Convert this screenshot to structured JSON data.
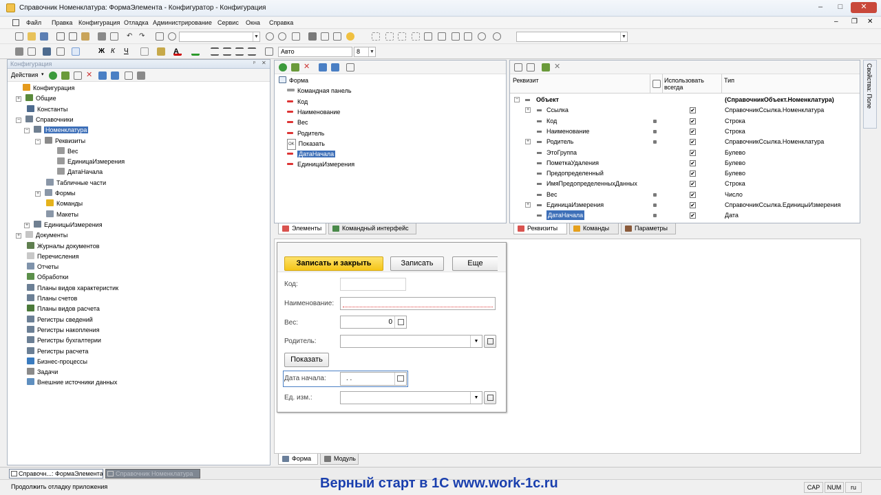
{
  "window": {
    "title": "Справочник Номенклатура: ФормаЭлемента - Конфигуратор - Конфигурация",
    "min": "–",
    "max": "□",
    "close": "✕",
    "inner_min": "–",
    "inner_restore": "❐",
    "inner_close": "✕"
  },
  "menu": [
    "Файл",
    "Правка",
    "Конфигурация",
    "Отладка",
    "Администрирование",
    "Сервис",
    "Окна",
    "Справка"
  ],
  "toolbar": {
    "font_value": "Авто",
    "size_value": "8"
  },
  "config_panel": {
    "title": "Конфигурация",
    "pin": "ᵖ",
    "close": "✕",
    "actions_label": "Действия",
    "tree": [
      {
        "label": "Конфигурация",
        "depth": 0,
        "exp": "",
        "icon": "#e59a1c",
        "sel": false
      },
      {
        "label": "Общие",
        "depth": 1,
        "exp": "+",
        "icon": "#5a8a3c",
        "sel": false
      },
      {
        "label": "Константы",
        "depth": 1,
        "exp": "",
        "icon": "#4d6b8f",
        "sel": false
      },
      {
        "label": "Справочники",
        "depth": 1,
        "exp": "−",
        "icon": "#6f7f91",
        "sel": false
      },
      {
        "label": "Номенклатура",
        "depth": 2,
        "exp": "−",
        "icon": "#6f7f91",
        "sel": true
      },
      {
        "label": "Реквизиты",
        "depth": 3,
        "exp": "−",
        "icon": "#8a8a8a",
        "sel": false
      },
      {
        "label": "Вес",
        "depth": 4,
        "exp": "",
        "icon": "#9a9a9a",
        "sel": false
      },
      {
        "label": "ЕдиницаИзмерения",
        "depth": 4,
        "exp": "",
        "icon": "#9a9a9a",
        "sel": false
      },
      {
        "label": "ДатаНачала",
        "depth": 4,
        "exp": "",
        "icon": "#9a9a9a",
        "sel": false
      },
      {
        "label": "Табличные части",
        "depth": 3,
        "exp": "",
        "icon": "#8a97a8",
        "sel": false
      },
      {
        "label": "Формы",
        "depth": 3,
        "exp": "+",
        "icon": "#8a97a8",
        "sel": false
      },
      {
        "label": "Команды",
        "depth": 3,
        "exp": "",
        "icon": "#e5b21c",
        "sel": false
      },
      {
        "label": "Макеты",
        "depth": 3,
        "exp": "",
        "icon": "#8a97a8",
        "sel": false
      },
      {
        "label": "ЕдиницыИзмерения",
        "depth": 2,
        "exp": "+",
        "icon": "#6f7f91",
        "sel": false
      },
      {
        "label": "Документы",
        "depth": 1,
        "exp": "+",
        "icon": "#c5c5c5",
        "sel": false
      },
      {
        "label": "Журналы документов",
        "depth": 1,
        "exp": "",
        "icon": "#5f7f4f",
        "sel": false
      },
      {
        "label": "Перечисления",
        "depth": 1,
        "exp": "",
        "icon": "#c8c8c8",
        "sel": false
      },
      {
        "label": "Отчеты",
        "depth": 1,
        "exp": "",
        "icon": "#7f93ab",
        "sel": false
      },
      {
        "label": "Обработки",
        "depth": 1,
        "exp": "",
        "icon": "#5b8f4a",
        "sel": false
      },
      {
        "label": "Планы видов характеристик",
        "depth": 1,
        "exp": "",
        "icon": "#6b7f95",
        "sel": false
      },
      {
        "label": "Планы счетов",
        "depth": 1,
        "exp": "",
        "icon": "#6b7f95",
        "sel": false
      },
      {
        "label": "Планы видов расчета",
        "depth": 1,
        "exp": "",
        "icon": "#4b7a3a",
        "sel": false
      },
      {
        "label": "Регистры сведений",
        "depth": 1,
        "exp": "",
        "icon": "#6b7f95",
        "sel": false
      },
      {
        "label": "Регистры накопления",
        "depth": 1,
        "exp": "",
        "icon": "#6b7f95",
        "sel": false
      },
      {
        "label": "Регистры бухгалтерии",
        "depth": 1,
        "exp": "",
        "icon": "#6b7f95",
        "sel": false
      },
      {
        "label": "Регистры расчета",
        "depth": 1,
        "exp": "",
        "icon": "#6b7f95",
        "sel": false
      },
      {
        "label": "Бизнес-процессы",
        "depth": 1,
        "exp": "",
        "icon": "#3a7bbf",
        "sel": false
      },
      {
        "label": "Задачи",
        "depth": 1,
        "exp": "",
        "icon": "#8a8a8a",
        "sel": false
      },
      {
        "label": "Внешние источники данных",
        "depth": 1,
        "exp": "",
        "icon": "#5f8fbf",
        "sel": false
      }
    ]
  },
  "elements_tree": [
    {
      "label": "Форма",
      "type": "form",
      "depth": 0,
      "sel": false
    },
    {
      "label": "Командная панель",
      "type": "panel",
      "depth": 1,
      "sel": false
    },
    {
      "label": "Код",
      "type": "field",
      "depth": 1,
      "sel": false
    },
    {
      "label": "Наименование",
      "type": "field",
      "depth": 1,
      "sel": false
    },
    {
      "label": "Вес",
      "type": "field",
      "depth": 1,
      "sel": false
    },
    {
      "label": "Родитель",
      "type": "field",
      "depth": 1,
      "sel": false
    },
    {
      "label": "Показать",
      "type": "button",
      "button_tag": "OK",
      "depth": 1,
      "sel": false
    },
    {
      "label": "ДатаНачала",
      "type": "field",
      "depth": 1,
      "sel": true
    },
    {
      "label": "ЕдиницаИзмерения",
      "type": "field",
      "depth": 1,
      "sel": false
    }
  ],
  "elements_tabs": [
    "Элементы",
    "Командный интерфейс"
  ],
  "attributes": {
    "columns": [
      "Реквизит",
      "Использовать всегда",
      "Тип"
    ],
    "root": {
      "name": "Объект",
      "type": "(СправочникОбъект.Номенклатура)"
    },
    "rows": [
      {
        "name": "Ссылка",
        "exp": "+",
        "dot": false,
        "checked": true,
        "type": "СправочникСсылка.Номенклатура",
        "sel": false
      },
      {
        "name": "Код",
        "exp": "",
        "dot": true,
        "checked": true,
        "type": "Строка",
        "sel": false
      },
      {
        "name": "Наименование",
        "exp": "",
        "dot": true,
        "checked": true,
        "type": "Строка",
        "sel": false
      },
      {
        "name": "Родитель",
        "exp": "+",
        "dot": true,
        "checked": true,
        "type": "СправочникСсылка.Номенклатура",
        "sel": false
      },
      {
        "name": "ЭтоГруппа",
        "exp": "",
        "dot": false,
        "checked": true,
        "type": "Булево",
        "sel": false
      },
      {
        "name": "ПометкаУдаления",
        "exp": "",
        "dot": false,
        "checked": true,
        "type": "Булево",
        "sel": false
      },
      {
        "name": "Предопределенный",
        "exp": "",
        "dot": false,
        "checked": true,
        "type": "Булево",
        "sel": false
      },
      {
        "name": "ИмяПредопределенныхДанных",
        "exp": "",
        "dot": false,
        "checked": true,
        "type": "Строка",
        "sel": false
      },
      {
        "name": "Вес",
        "exp": "",
        "dot": true,
        "checked": true,
        "type": "Число",
        "sel": false
      },
      {
        "name": "ЕдиницаИзмерения",
        "exp": "+",
        "dot": true,
        "checked": true,
        "type": "СправочникСсылка.ЕдиницыИзмерения",
        "sel": false
      },
      {
        "name": "ДатаНачала",
        "exp": "",
        "dot": true,
        "checked": true,
        "type": "Дата",
        "sel": true
      }
    ],
    "tabs": [
      "Реквизиты",
      "Команды",
      "Параметры"
    ]
  },
  "check_mark": "✔",
  "side_tab": "Свойства: Поле",
  "preview": {
    "save_close_label": "Записать и закрыть",
    "save_label": "Записать",
    "more_label": "Еще",
    "fields": {
      "code_label": "Код:",
      "name_label": "Наименование:",
      "weight_label": "Вес:",
      "weight_value": "0",
      "parent_label": "Родитель:",
      "show_label": "Показать",
      "date_label": "Дата начала:",
      "date_value": " .  .",
      "unit_label": "Ед. изм.:"
    }
  },
  "designer_tabs": [
    "Форма",
    "Модуль"
  ],
  "taskbar": [
    "Справочн...: ФормаЭлемента",
    "Справочник Номенклатура"
  ],
  "status": {
    "text": "Продолжить отладку приложения",
    "caps": "CAP",
    "num": "NUM",
    "lang": "ru"
  },
  "watermark": "Верный старт в 1С www.work-1c.ru",
  "colors": {
    "accent_yellow": "#f5c518",
    "selection": "#3d6fb8",
    "watermark": "#1a3fae"
  }
}
